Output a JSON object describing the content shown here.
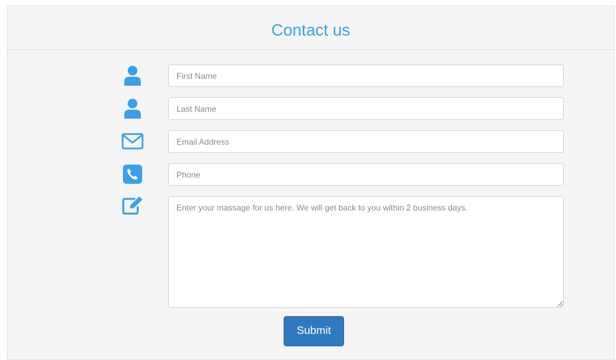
{
  "header": {
    "title": "Contact us"
  },
  "form": {
    "first_name": {
      "placeholder": "First Name",
      "icon": "user-icon"
    },
    "last_name": {
      "placeholder": "Last Name",
      "icon": "user-icon"
    },
    "email": {
      "placeholder": "Email Address",
      "icon": "envelope-icon"
    },
    "phone": {
      "placeholder": "Phone",
      "icon": "phone-icon"
    },
    "message": {
      "placeholder": "Enter your massage for us here. We will get back to you within 2 business days.",
      "icon": "edit-icon"
    },
    "submit_label": "Submit"
  },
  "colors": {
    "accent": "#3aa0ea",
    "button": "#3079c0",
    "background": "#f5f5f5"
  }
}
